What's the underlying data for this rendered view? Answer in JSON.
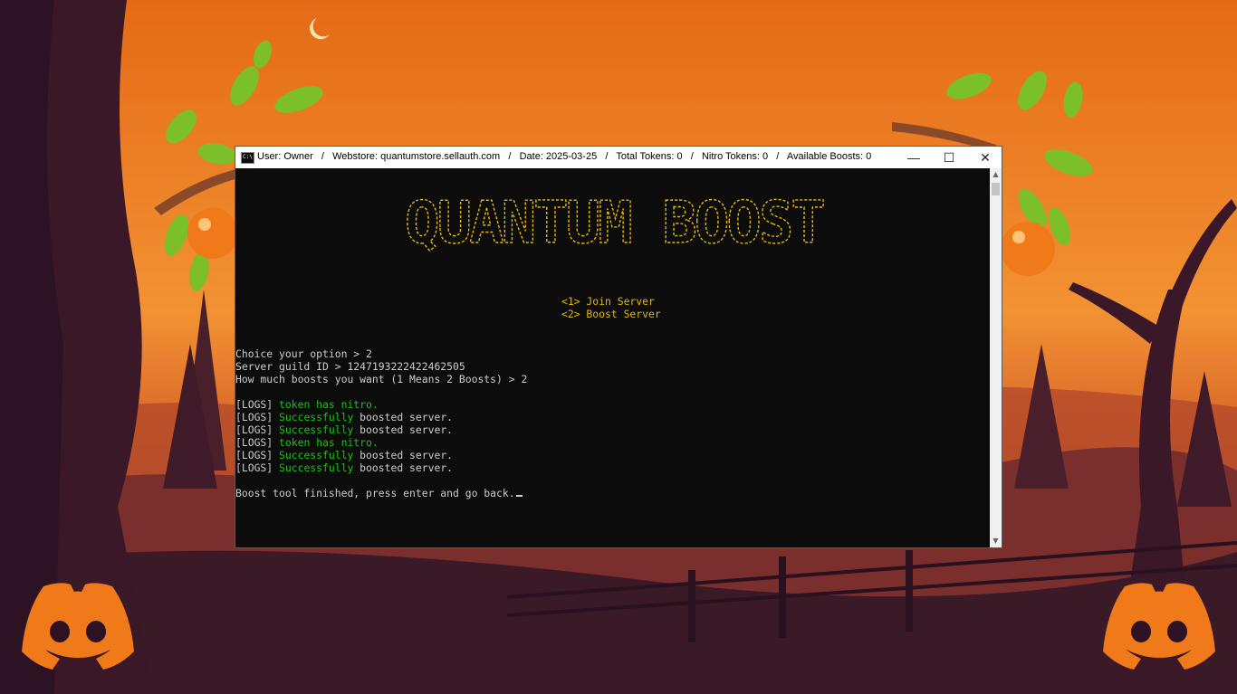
{
  "window": {
    "title": "User: Owner   /   Webstore: quantumstore.sellauth.com   /   Date: 2025-03-25   /   Total Tokens: 0   /   Nitro Tokens: 0   /   Available Boosts: 0",
    "icon": "cmd-icon",
    "icon_text": "C:\\",
    "minimize_glyph": "—",
    "maximize_glyph": "☐",
    "close_glyph": "✕"
  },
  "banner": {
    "text": "QUANTUM BOOST",
    "color": "#e9b600"
  },
  "menu": [
    "<1> Join Server",
    "<2> Boost Server"
  ],
  "prompts": [
    "Choice your option > 2",
    "Server guild ID > 1247193222422462505",
    "How much boosts you want (1 Means 2 Boosts) > 2"
  ],
  "logs": [
    {
      "tag": "[LOGS]",
      "highlight": "token has nitro.",
      "rest": ""
    },
    {
      "tag": "[LOGS]",
      "highlight": "Successfully",
      "rest": " boosted server."
    },
    {
      "tag": "[LOGS]",
      "highlight": "Successfully",
      "rest": " boosted server."
    },
    {
      "tag": "[LOGS]",
      "highlight": "token has nitro.",
      "rest": ""
    },
    {
      "tag": "[LOGS]",
      "highlight": "Successfully",
      "rest": " boosted server."
    },
    {
      "tag": "[LOGS]",
      "highlight": "Successfully",
      "rest": " boosted server."
    }
  ],
  "finish_message": "Boost tool finished, press enter and go back.",
  "colors": {
    "console_bg": "#0c0c0c",
    "console_text": "#cccccc",
    "success_green": "#16c60c",
    "menu_yellow": "#e9b600",
    "discord_orange": "#f07a1a"
  }
}
